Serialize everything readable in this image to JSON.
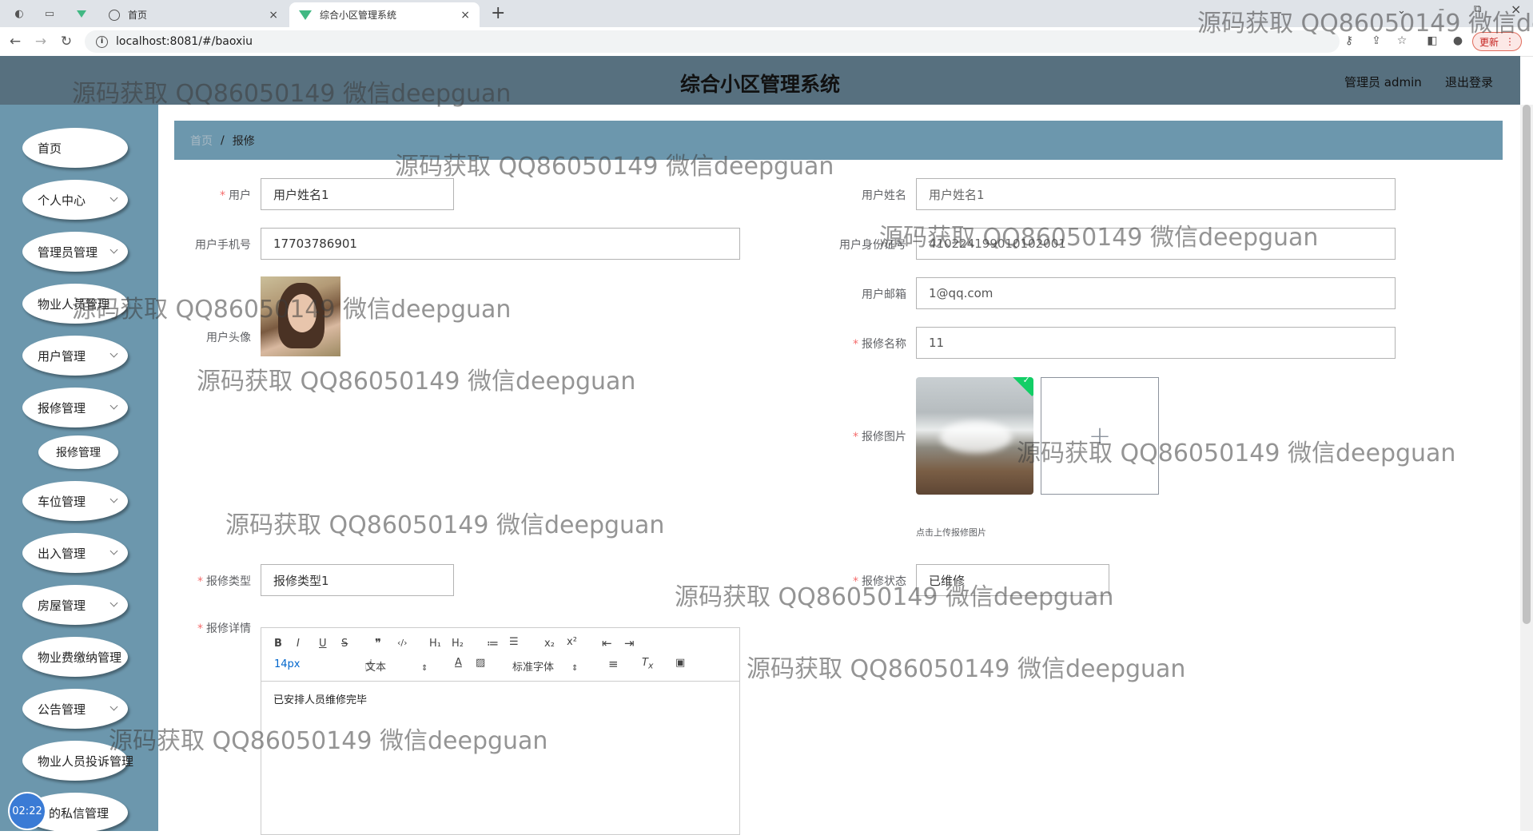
{
  "browser": {
    "tabs": [
      {
        "title": "首页"
      },
      {
        "title": "综合小区管理系统"
      }
    ],
    "new_tab": "+",
    "url": "localhost:8081/#/baoxiu",
    "update_label": "更新",
    "close": "×"
  },
  "header": {
    "title": "综合小区管理系统",
    "user": "管理员 admin",
    "logout": "退出登录"
  },
  "sidebar": {
    "items": [
      {
        "label": "首页"
      },
      {
        "label": "个人中心"
      },
      {
        "label": "管理员管理"
      },
      {
        "label": "物业人员管理"
      },
      {
        "label": "用户管理"
      },
      {
        "label": "报修管理"
      },
      {
        "label": "车位管理"
      },
      {
        "label": "出入管理"
      },
      {
        "label": "房屋管理"
      },
      {
        "label": "物业费缴纳管理"
      },
      {
        "label": "公告管理"
      },
      {
        "label": "物业人员投诉管理"
      },
      {
        "label": "的私信管理"
      }
    ],
    "sub_item": "报修管理",
    "timer": "02:22"
  },
  "breadcrumb": {
    "home": "首页",
    "separator": "/",
    "current": "报修"
  },
  "form": {
    "user_label": "用户",
    "user_value": "用户姓名1",
    "username_label": "用户姓名",
    "username_value": "用户姓名1",
    "phone_label": "用户手机号",
    "phone_value": "17703786901",
    "idcard_label": "用户身份证号",
    "idcard_value": "410224199010102001",
    "email_label": "用户邮箱",
    "email_value": "1@qq.com",
    "avatar_label": "用户头像",
    "repair_name_label": "报修名称",
    "repair_name_value": "11",
    "repair_image_label": "报修图片",
    "upload_plus": "+",
    "upload_tip": "点击上传报修图片",
    "repair_type_label": "报修类型",
    "repair_type_value": "报修类型1",
    "repair_status_label": "报修状态",
    "repair_status_value": "已维修",
    "repair_detail_label": "报修详情",
    "required_mark": "*"
  },
  "editor": {
    "buttons": {
      "bold": "B",
      "italic": "I",
      "underline": "U",
      "strike": "S",
      "quote": "❞",
      "code": "‹/›",
      "h1": "H₁",
      "h2": "H₂",
      "ol": "≔",
      "ul": "☰",
      "sub": "x₂",
      "sup": "x²",
      "outdent": "⇤",
      "indent": "⇥"
    },
    "size": "14px",
    "format": "文本",
    "font": "标准字体",
    "content": "已安排人员维修完毕"
  },
  "watermark": "源码获取 QQ86050149 微信deepguan",
  "watermark_partial": "源码获取 QQ86050149 微信de"
}
